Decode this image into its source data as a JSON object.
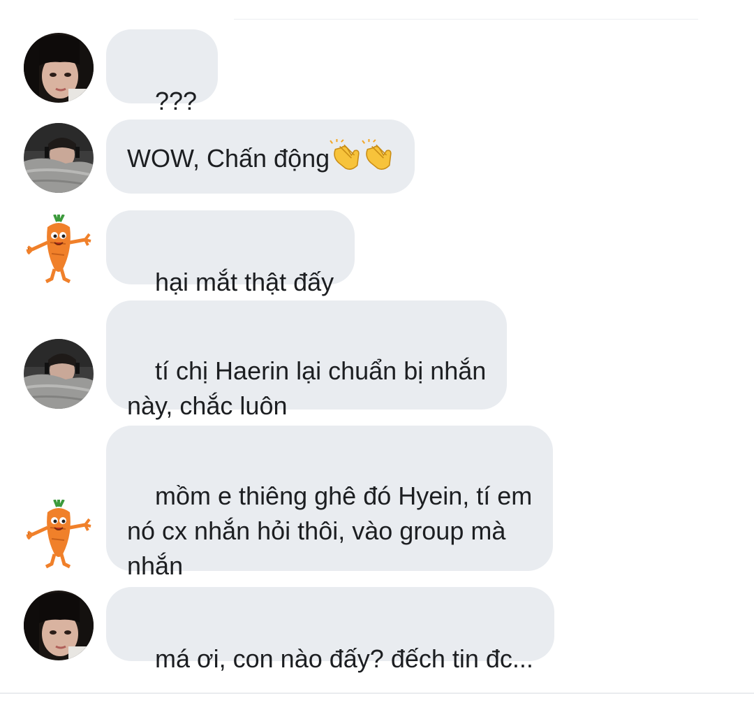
{
  "conversation": {
    "messages": [
      {
        "sender_avatar": "avatar-girl-bangs",
        "text": "???",
        "emoji": []
      },
      {
        "sender_avatar": "avatar-boy-headphones",
        "text": "WOW, Chấn động",
        "emoji": [
          "clapping-hands-icon",
          "clapping-hands-icon"
        ]
      },
      {
        "sender_avatar": "avatar-carrot-mascot",
        "text": "hại mắt thật đấy",
        "emoji": []
      },
      {
        "sender_avatar": "avatar-boy-headphones",
        "text": "tí chị Haerin lại chuẩn bị nhắn\nnày, chắc luôn",
        "emoji": []
      },
      {
        "sender_avatar": "avatar-carrot-mascot",
        "text": "mồm e thiêng ghê đó Hyein, tí em\nnó cx nhắn hỏi thôi, vào group mà\nnhắn",
        "emoji": []
      },
      {
        "sender_avatar": "avatar-girl-bangs",
        "text": "má ơi, con nào đấy? đếch tin đc...",
        "emoji": []
      }
    ]
  },
  "colors": {
    "bubble_bg": "#e9ecf0",
    "text": "#1c1e21",
    "divider": "#e9ebee"
  }
}
